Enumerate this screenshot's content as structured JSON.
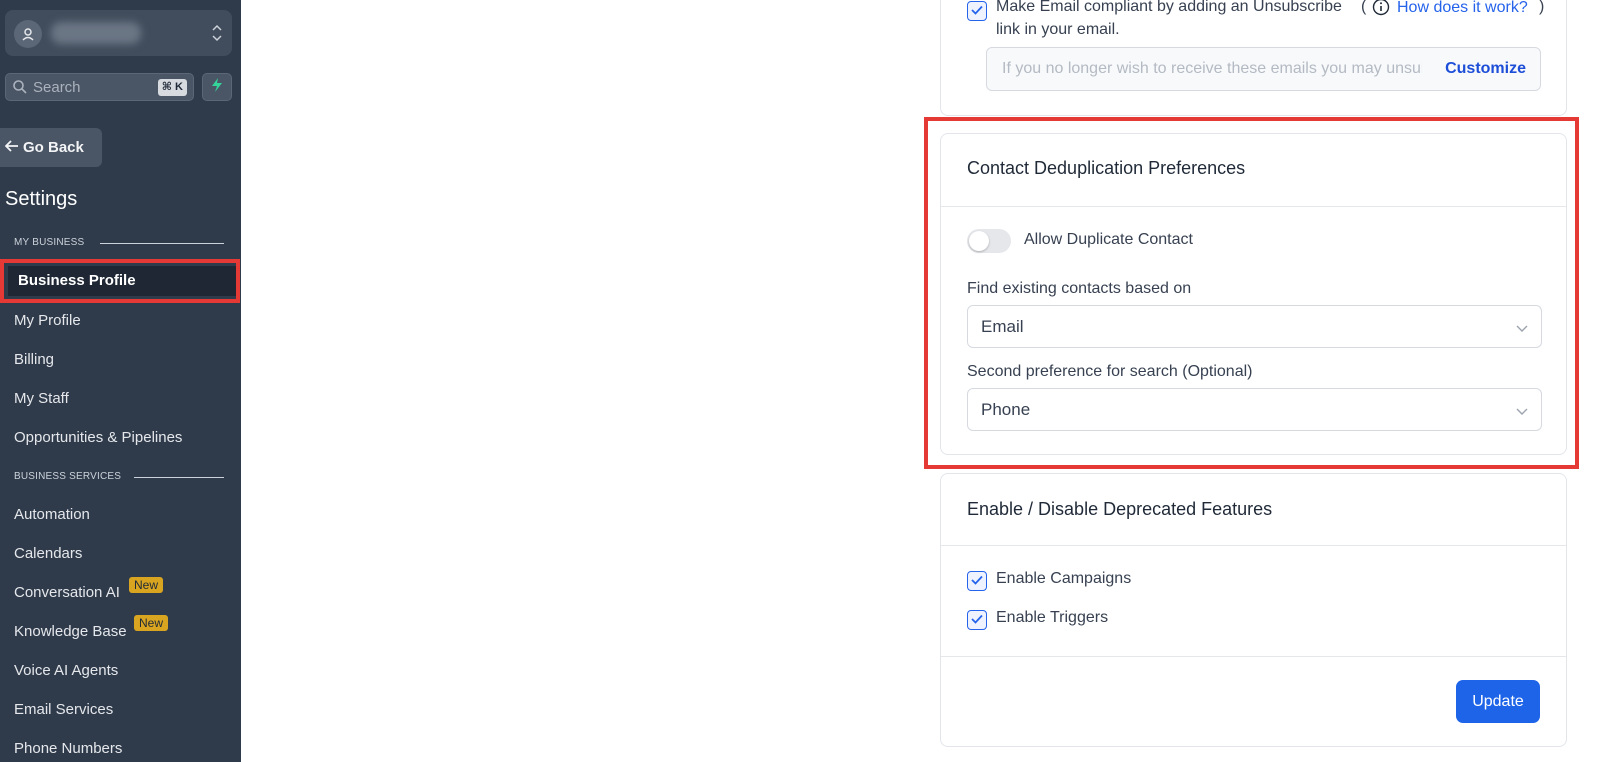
{
  "sidebar": {
    "search_placeholder": "Search",
    "search_shortcut": "⌘ K",
    "go_back": "Go Back",
    "settings_title": "Settings",
    "section_my_business": "MY BUSINESS",
    "section_business_services": "BUSINESS SERVICES",
    "items": [
      {
        "label": "Business Profile",
        "active": true
      },
      {
        "label": "My Profile"
      },
      {
        "label": "Billing"
      },
      {
        "label": "My Staff"
      },
      {
        "label": "Opportunities & Pipelines"
      },
      {
        "label": "Automation"
      },
      {
        "label": "Calendars"
      },
      {
        "label": "Conversation AI",
        "badge": "New"
      },
      {
        "label": "Knowledge Base",
        "badge": "New"
      },
      {
        "label": "Voice AI Agents"
      },
      {
        "label": "Email Services"
      },
      {
        "label": "Phone Numbers"
      }
    ]
  },
  "email_compliance": {
    "checkbox_label_line1": "Make Email compliant by adding an Unsubscribe",
    "checkbox_label_line2": "link in your email.",
    "paren_open": "(",
    "paren_close": ")",
    "how_link": "How does it work?",
    "unsubscribe_placeholder": "If you no longer wish to receive these emails you may unsubscribe",
    "customize_label": "Customize",
    "checked": true
  },
  "dedup": {
    "title": "Contact Deduplication Preferences",
    "toggle_label": "Allow Duplicate Contact",
    "toggle_on": false,
    "find_label": "Find existing contacts based on",
    "find_value": "Email",
    "second_label": "Second preference for search (Optional)",
    "second_value": "Phone"
  },
  "features": {
    "title": "Enable / Disable Deprecated Features",
    "campaigns_label": "Enable Campaigns",
    "triggers_label": "Enable Triggers",
    "campaigns_checked": true,
    "triggers_checked": true,
    "update_label": "Update"
  },
  "colors": {
    "sidebar_bg": "#2f3b4b",
    "accent_blue": "#1d64e8",
    "highlight_red": "#e53935",
    "badge_gold": "#d9a520"
  }
}
